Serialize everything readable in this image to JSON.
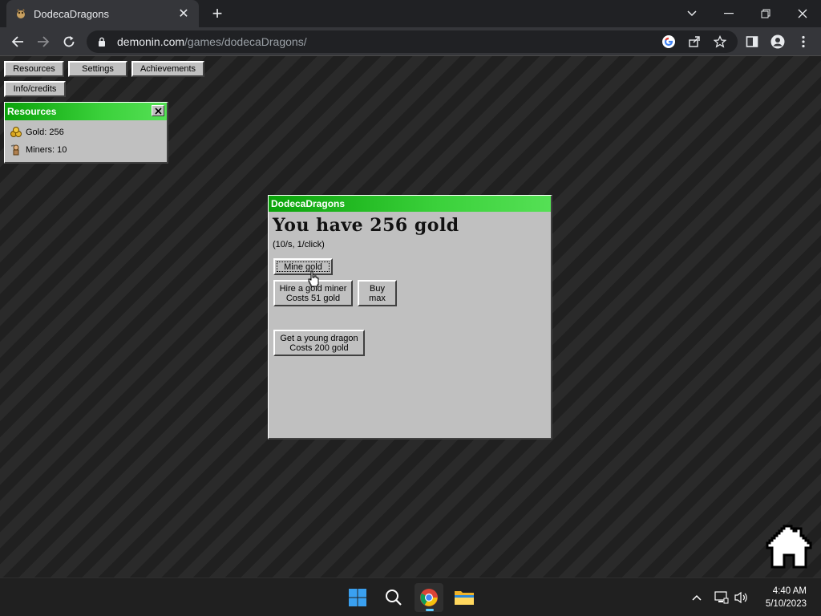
{
  "browser": {
    "tab_title": "DodecaDragons",
    "new_tab_label": "+",
    "url_host": "demonin.com",
    "url_path": "/games/dodecaDragons/"
  },
  "game": {
    "nav": {
      "resources": "Resources",
      "settings": "Settings",
      "achievements": "Achievements",
      "info_credits": "Info/credits"
    },
    "resources_panel": {
      "title": "Resources",
      "gold": "Gold: 256",
      "miners": "Miners: 10"
    },
    "main_window": {
      "title": "DodecaDragons",
      "headline": "You have 256 gold",
      "rate": "(10/s, 1/click)",
      "mine_button": "Mine gold",
      "hire_line1": "Hire a gold miner",
      "hire_line2": "Costs 51 gold",
      "buy_max_line1": "Buy",
      "buy_max_line2": "max",
      "dragon_line1": "Get a young dragon",
      "dragon_line2": "Costs 200 gold"
    }
  },
  "taskbar": {
    "time": "4:40 AM",
    "date": "5/10/2023"
  },
  "colors": {
    "window_title_green": "#0aa30a",
    "panel_gray": "#c0c0c0",
    "chrome_dark": "#202124"
  }
}
